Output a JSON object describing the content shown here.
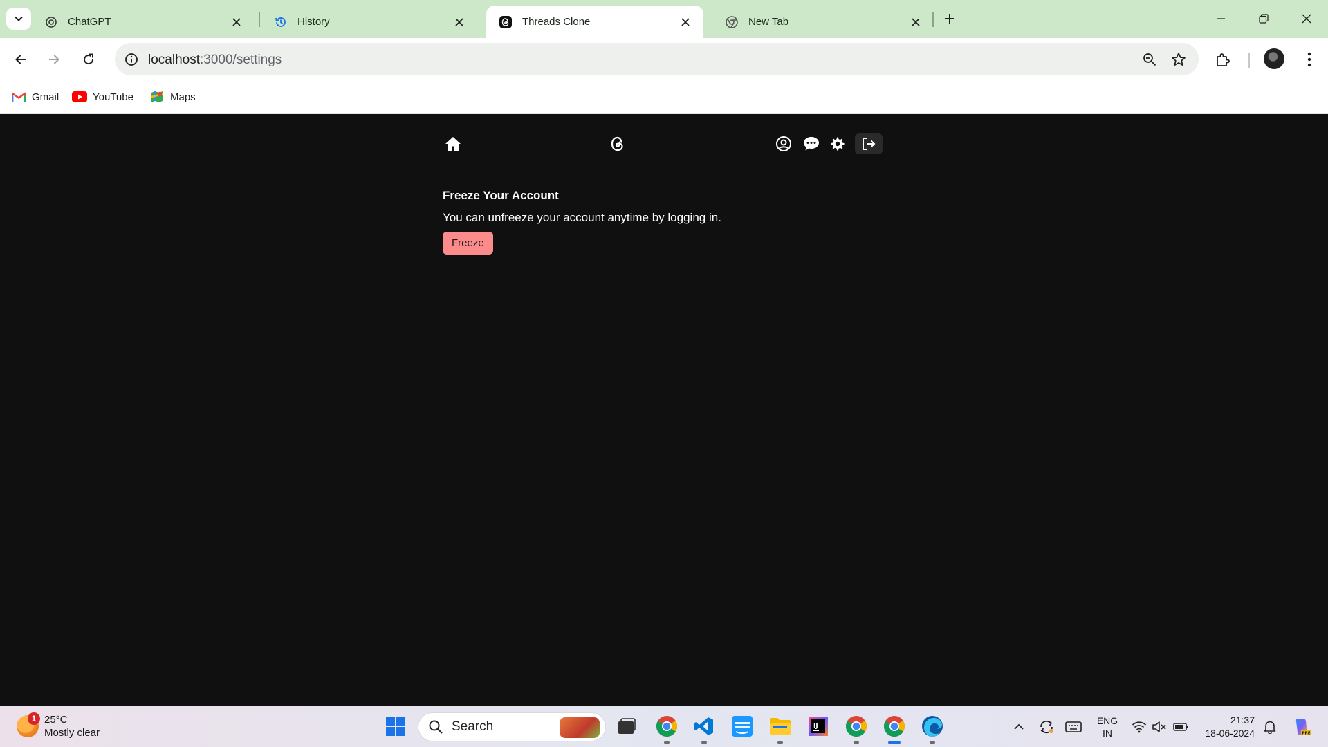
{
  "browser": {
    "tabs": [
      {
        "title": "ChatGPT",
        "favicon": "chatgpt-icon",
        "active": false
      },
      {
        "title": "History",
        "favicon": "history-icon",
        "active": false
      },
      {
        "title": "Threads Clone",
        "favicon": "threads-icon",
        "active": true
      },
      {
        "title": "New Tab",
        "favicon": "chrome-icon",
        "active": false
      }
    ],
    "url_host": "localhost",
    "url_path": ":3000/settings",
    "bookmarks": [
      {
        "label": "Gmail",
        "icon": "gmail-icon"
      },
      {
        "label": "YouTube",
        "icon": "youtube-icon"
      },
      {
        "label": "Maps",
        "icon": "maps-icon"
      }
    ],
    "colors": {
      "tabstrip": "#cde8c8",
      "omnibox": "#eef0ed"
    }
  },
  "app": {
    "header_icons": [
      "home-icon",
      "threads-logo-icon",
      "user-profile-icon",
      "chat-icon",
      "settings-gear-icon",
      "logout-icon"
    ],
    "freeze": {
      "title": "Freeze Your Account",
      "description": "You can unfreeze your account anytime by logging in.",
      "button_label": "Freeze"
    },
    "colors": {
      "background": "#101010",
      "freeze_button": "#fc8c8c"
    }
  },
  "taskbar": {
    "weather": {
      "temp": "25°C",
      "condition": "Mostly clear",
      "badge": "1"
    },
    "search_label": "Search",
    "apps": [
      "start-icon",
      "task-view-icon",
      "chrome-icon",
      "vscode-icon",
      "prime-video-icon",
      "file-explorer-icon",
      "intellij-icon",
      "chrome-icon",
      "chrome-icon",
      "edge-icon"
    ],
    "lang_line1": "ENG",
    "lang_line2": "IN",
    "time": "21:37",
    "date": "18-06-2024"
  }
}
